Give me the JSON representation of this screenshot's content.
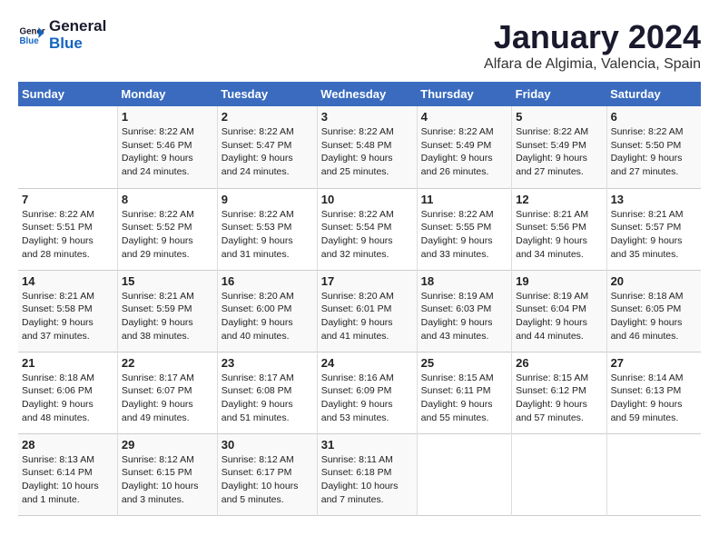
{
  "logo": {
    "line1": "General",
    "line2": "Blue"
  },
  "title": "January 2024",
  "location": "Alfara de Algimia, Valencia, Spain",
  "days_header": [
    "Sunday",
    "Monday",
    "Tuesday",
    "Wednesday",
    "Thursday",
    "Friday",
    "Saturday"
  ],
  "weeks": [
    [
      {
        "day": "",
        "content": ""
      },
      {
        "day": "1",
        "content": "Sunrise: 8:22 AM\nSunset: 5:46 PM\nDaylight: 9 hours\nand 24 minutes."
      },
      {
        "day": "2",
        "content": "Sunrise: 8:22 AM\nSunset: 5:47 PM\nDaylight: 9 hours\nand 24 minutes."
      },
      {
        "day": "3",
        "content": "Sunrise: 8:22 AM\nSunset: 5:48 PM\nDaylight: 9 hours\nand 25 minutes."
      },
      {
        "day": "4",
        "content": "Sunrise: 8:22 AM\nSunset: 5:49 PM\nDaylight: 9 hours\nand 26 minutes."
      },
      {
        "day": "5",
        "content": "Sunrise: 8:22 AM\nSunset: 5:49 PM\nDaylight: 9 hours\nand 27 minutes."
      },
      {
        "day": "6",
        "content": "Sunrise: 8:22 AM\nSunset: 5:50 PM\nDaylight: 9 hours\nand 27 minutes."
      }
    ],
    [
      {
        "day": "7",
        "content": "Sunrise: 8:22 AM\nSunset: 5:51 PM\nDaylight: 9 hours\nand 28 minutes."
      },
      {
        "day": "8",
        "content": "Sunrise: 8:22 AM\nSunset: 5:52 PM\nDaylight: 9 hours\nand 29 minutes."
      },
      {
        "day": "9",
        "content": "Sunrise: 8:22 AM\nSunset: 5:53 PM\nDaylight: 9 hours\nand 31 minutes."
      },
      {
        "day": "10",
        "content": "Sunrise: 8:22 AM\nSunset: 5:54 PM\nDaylight: 9 hours\nand 32 minutes."
      },
      {
        "day": "11",
        "content": "Sunrise: 8:22 AM\nSunset: 5:55 PM\nDaylight: 9 hours\nand 33 minutes."
      },
      {
        "day": "12",
        "content": "Sunrise: 8:21 AM\nSunset: 5:56 PM\nDaylight: 9 hours\nand 34 minutes."
      },
      {
        "day": "13",
        "content": "Sunrise: 8:21 AM\nSunset: 5:57 PM\nDaylight: 9 hours\nand 35 minutes."
      }
    ],
    [
      {
        "day": "14",
        "content": "Sunrise: 8:21 AM\nSunset: 5:58 PM\nDaylight: 9 hours\nand 37 minutes."
      },
      {
        "day": "15",
        "content": "Sunrise: 8:21 AM\nSunset: 5:59 PM\nDaylight: 9 hours\nand 38 minutes."
      },
      {
        "day": "16",
        "content": "Sunrise: 8:20 AM\nSunset: 6:00 PM\nDaylight: 9 hours\nand 40 minutes."
      },
      {
        "day": "17",
        "content": "Sunrise: 8:20 AM\nSunset: 6:01 PM\nDaylight: 9 hours\nand 41 minutes."
      },
      {
        "day": "18",
        "content": "Sunrise: 8:19 AM\nSunset: 6:03 PM\nDaylight: 9 hours\nand 43 minutes."
      },
      {
        "day": "19",
        "content": "Sunrise: 8:19 AM\nSunset: 6:04 PM\nDaylight: 9 hours\nand 44 minutes."
      },
      {
        "day": "20",
        "content": "Sunrise: 8:18 AM\nSunset: 6:05 PM\nDaylight: 9 hours\nand 46 minutes."
      }
    ],
    [
      {
        "day": "21",
        "content": "Sunrise: 8:18 AM\nSunset: 6:06 PM\nDaylight: 9 hours\nand 48 minutes."
      },
      {
        "day": "22",
        "content": "Sunrise: 8:17 AM\nSunset: 6:07 PM\nDaylight: 9 hours\nand 49 minutes."
      },
      {
        "day": "23",
        "content": "Sunrise: 8:17 AM\nSunset: 6:08 PM\nDaylight: 9 hours\nand 51 minutes."
      },
      {
        "day": "24",
        "content": "Sunrise: 8:16 AM\nSunset: 6:09 PM\nDaylight: 9 hours\nand 53 minutes."
      },
      {
        "day": "25",
        "content": "Sunrise: 8:15 AM\nSunset: 6:11 PM\nDaylight: 9 hours\nand 55 minutes."
      },
      {
        "day": "26",
        "content": "Sunrise: 8:15 AM\nSunset: 6:12 PM\nDaylight: 9 hours\nand 57 minutes."
      },
      {
        "day": "27",
        "content": "Sunrise: 8:14 AM\nSunset: 6:13 PM\nDaylight: 9 hours\nand 59 minutes."
      }
    ],
    [
      {
        "day": "28",
        "content": "Sunrise: 8:13 AM\nSunset: 6:14 PM\nDaylight: 10 hours\nand 1 minute."
      },
      {
        "day": "29",
        "content": "Sunrise: 8:12 AM\nSunset: 6:15 PM\nDaylight: 10 hours\nand 3 minutes."
      },
      {
        "day": "30",
        "content": "Sunrise: 8:12 AM\nSunset: 6:17 PM\nDaylight: 10 hours\nand 5 minutes."
      },
      {
        "day": "31",
        "content": "Sunrise: 8:11 AM\nSunset: 6:18 PM\nDaylight: 10 hours\nand 7 minutes."
      },
      {
        "day": "",
        "content": ""
      },
      {
        "day": "",
        "content": ""
      },
      {
        "day": "",
        "content": ""
      }
    ]
  ]
}
